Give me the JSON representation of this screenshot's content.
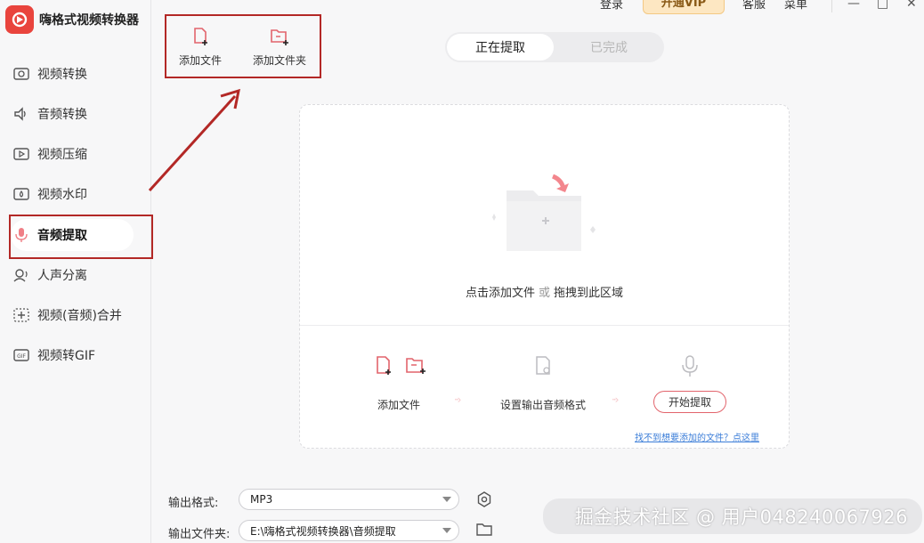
{
  "app": {
    "title": "嗨格式视频转换器"
  },
  "header": {
    "login": "登录",
    "vip": "开通VIP",
    "service": "客服",
    "menu": "菜单"
  },
  "sidebar": {
    "items": [
      {
        "label": "视频转换",
        "icon": "video-convert-icon"
      },
      {
        "label": "音频转换",
        "icon": "speaker-icon"
      },
      {
        "label": "视频压缩",
        "icon": "compress-icon"
      },
      {
        "label": "视频水印",
        "icon": "watermark-icon"
      },
      {
        "label": "音频提取",
        "icon": "microphone-icon",
        "active": true
      },
      {
        "label": "人声分离",
        "icon": "voice-separate-icon"
      },
      {
        "label": "视频(音频)合并",
        "icon": "merge-icon"
      },
      {
        "label": "视频转GIF",
        "icon": "gif-icon"
      }
    ]
  },
  "toolbar": {
    "add_file": "添加文件",
    "add_folder": "添加文件夹"
  },
  "tabs": {
    "extracting": "正在提取",
    "done": "已完成"
  },
  "drop_zone": {
    "hint_click": "点击添加文件",
    "hint_or": "或",
    "hint_drag": "拖拽到此区域",
    "step1": "添加文件",
    "step2": "设置输出音频格式",
    "start_button": "开始提取",
    "help_link": "找不到想要添加的文件？点这里"
  },
  "settings": {
    "format_label": "输出格式:",
    "format_value": "MP3",
    "folder_label": "输出文件夹:",
    "folder_value": "E:\\嗨格式视频转换器\\音频提取"
  },
  "watermark": "掘金技术社区 @ 用户048240067926",
  "colors": {
    "accent": "#e9443d",
    "annotation": "#b32826",
    "link": "#3b7dd8"
  }
}
